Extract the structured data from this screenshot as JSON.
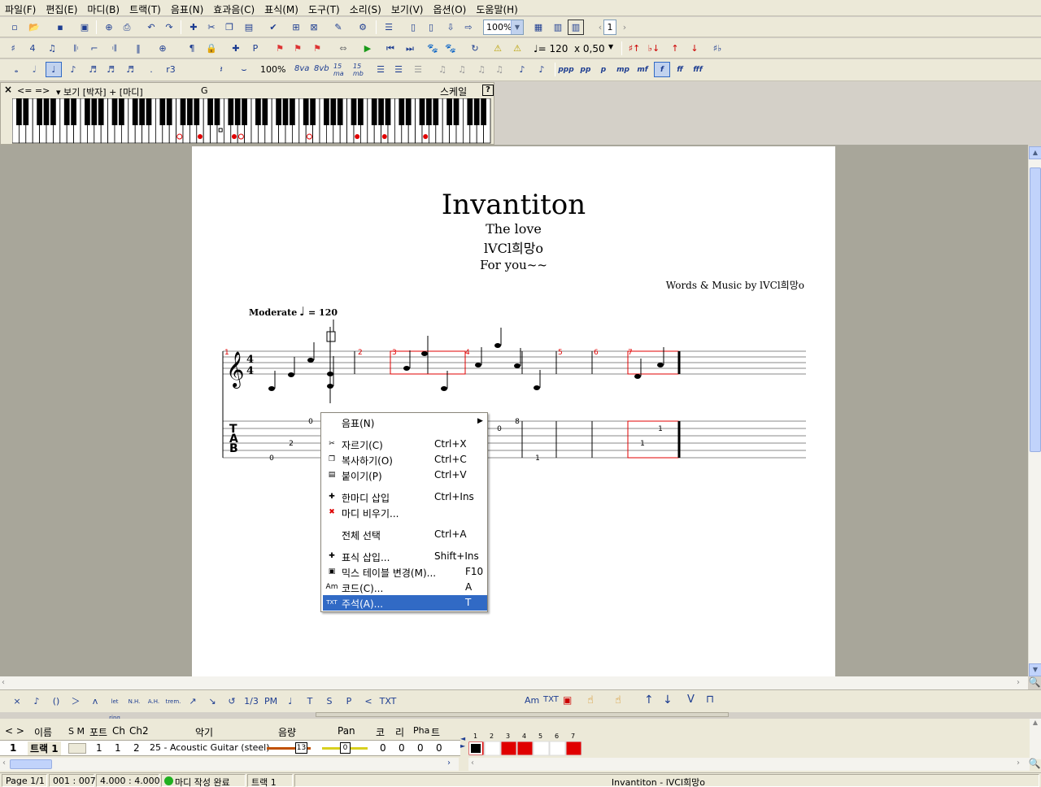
{
  "menu": [
    "파일(F)",
    "편집(E)",
    "마디(B)",
    "트랙(T)",
    "음표(N)",
    "효과음(C)",
    "표식(M)",
    "도구(T)",
    "소리(S)",
    "보기(V)",
    "옵션(O)",
    "도움말(H)"
  ],
  "toolbar1": {
    "zoom": "100%",
    "page": "1"
  },
  "toolbar2": {
    "tempo": "♩= 120",
    "speed": "x 0,50"
  },
  "toolbar3": {
    "zoom_label": "100%",
    "ottava": [
      "8va",
      "8vb",
      "15ma",
      "15mb"
    ]
  },
  "keyboard": {
    "close": "×",
    "nav": "<= =>",
    "view_label": "보기 [박자] + [마디]",
    "key": "G",
    "scale_label": "스케일",
    "help": "?"
  },
  "score": {
    "title": "Invantiton",
    "subtitle": "The love",
    "artist": "lVCl희망o",
    "album": "For you~~",
    "credits": "Words & Music by lVCl희망o",
    "tempo_label": "Moderate",
    "tempo_value": "= 120",
    "tab_label": "T\nA\nB",
    "measures": [
      "1",
      "2",
      "3",
      "4",
      "5",
      "6",
      "7"
    ],
    "tab_numbers": [
      "0",
      "2",
      "0",
      "8",
      "0",
      "1",
      "1",
      "1"
    ]
  },
  "context_menu": [
    {
      "label": "음표(N)",
      "shortcut": "",
      "submenu": true
    },
    {
      "label": "자르기(C)",
      "shortcut": "Ctrl+X"
    },
    {
      "label": "복사하기(O)",
      "shortcut": "Ctrl+C"
    },
    {
      "label": "붙이기(P)",
      "shortcut": "Ctrl+V"
    },
    {
      "label": "한마디 삽입",
      "shortcut": "Ctrl+Ins"
    },
    {
      "label": "마디 비우기...",
      "shortcut": ""
    },
    {
      "label": "전체 선택",
      "shortcut": "Ctrl+A"
    },
    {
      "label": "표식 삽입...",
      "shortcut": "Shift+Ins"
    },
    {
      "label": "믹스 테이블 변경(M)...",
      "shortcut": "F10"
    },
    {
      "label": "코드(C)...",
      "shortcut": "A"
    },
    {
      "label": "주석(A)...",
      "shortcut": "T",
      "selected": true
    }
  ],
  "effects_bar": {
    "items": [
      "×",
      "♪",
      "()",
      "＞",
      "ʌ",
      "let ring",
      "N.H.",
      "A.H.",
      "trem.",
      "↗",
      "↘",
      "↺",
      "1/3",
      "PM",
      "♩",
      "T",
      "S",
      "P",
      "<",
      "TXT"
    ]
  },
  "track_header": {
    "nav": "< >",
    "name": "이름",
    "sm": "S M",
    "port": "포트",
    "ch": "Ch",
    "ch2": "Ch2",
    "instrument": "악기",
    "volume": "음량",
    "pan": "Pan",
    "chorus": "코",
    "reverb": "리",
    "phaser": "Pha",
    "tremolo": "트"
  },
  "track_row": {
    "num": "1",
    "name": "트랙 1",
    "port": "1",
    "ch": "1",
    "ch2": "2",
    "instrument": "25 - Acoustic Guitar (steel)",
    "volume": "13",
    "pan": "0",
    "chorus": "0",
    "reverb": "0",
    "phaser": "0",
    "tremolo": "0"
  },
  "timeline": {
    "measures": [
      "1",
      "2",
      "3",
      "4",
      "5",
      "6",
      "7"
    ]
  },
  "status": {
    "page": "Page 1/1",
    "position": "001 : 007",
    "time": "4.000 : 4.000",
    "message": "마디 작성 완료",
    "track": "트랙 1",
    "song": "Invantiton - lVCl희망o"
  },
  "colors": {
    "selection": "#316ac5",
    "measure_filled": "#e00000",
    "paper": "#ffffff",
    "workspace": "#a8a69a"
  }
}
